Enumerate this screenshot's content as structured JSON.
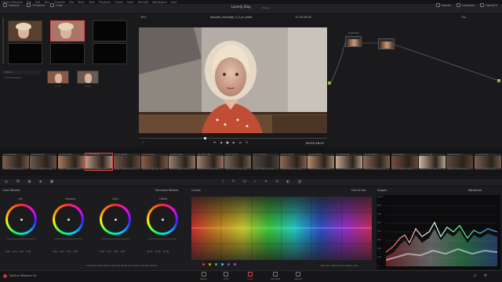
{
  "menu": [
    "DaVinci Resolve",
    "File",
    "Edit",
    "Trim",
    "Timeline",
    "Clip",
    "Mark",
    "View",
    "Playback",
    "Fusion",
    "Color",
    "Fairlight",
    "Workspace",
    "Help"
  ],
  "project_title": "Lovely Day",
  "project_status": "Edited",
  "top_left": {
    "gallery": "Gallery",
    "timelines": "Timeline",
    "clips": "Clips"
  },
  "top_right": {
    "nodes": "Nodes",
    "lightbox": "Lightbox",
    "openfx": "OpenFX"
  },
  "viewer": {
    "zoom": "39%",
    "timeline_name": "episode_montage_4_3_pr_static",
    "timecode": "15:36:28:08",
    "playhead_tc": "00:05:18:07",
    "clip_label": "Clip"
  },
  "media_pool": {
    "folder_name": "Stills 1",
    "power_grades": "PowerGrades 1",
    "stills": [
      {
        "label": "1.1.1",
        "tone": "#5a3e2e"
      },
      {
        "label": "1.1.2",
        "tone": "#a87768"
      },
      {
        "label": "",
        "tone": "#050505"
      },
      {
        "label": "",
        "tone": "#050505"
      },
      {
        "label": "",
        "tone": "#050505"
      },
      {
        "label": "",
        "tone": "#050505"
      }
    ],
    "stills_lower": [
      {
        "label": "1.3.1",
        "tone": "#8a5848"
      },
      {
        "label": "1.4.1",
        "tone": "#6d5a4e"
      }
    ]
  },
  "nodes": {
    "label": "Contrasts",
    "node_ids": [
      "01",
      "02"
    ]
  },
  "timeline_clips": [
    {
      "tc": "11:22:28:10",
      "name": "Apple ProRes 422 HQ",
      "tone": "#7d6050"
    },
    {
      "tc": "16:14:14:23",
      "name": "Apple ProRes 422 HQ",
      "tone": "#6b5a4d"
    },
    {
      "tc": "15:23:37:08",
      "name": "Apple ProRes 422 HQ",
      "tone": "#a77a5c"
    },
    {
      "tc": "15:36:28:08",
      "name": "Apple ProRes 422 HQ",
      "tone": "#c09a84"
    },
    {
      "tc": "15:23:28:09",
      "name": "Apple ProRes 422 HQ",
      "tone": "#6e5644"
    },
    {
      "tc": "15:26:40:12",
      "name": "Apple ProRes 422 HQ",
      "tone": "#8d5e48"
    },
    {
      "tc": "12:21:50:20",
      "name": "Apple ProRes 422 HQ",
      "tone": "#9a8070"
    },
    {
      "tc": "15:46:47:08",
      "name": "Apple ProRes 422 HQ",
      "tone": "#a6806c"
    },
    {
      "tc": "14:27:23:03",
      "name": "Apple ProRes 422 HQ",
      "tone": "#7a6958"
    },
    {
      "tc": "14:47:19:04",
      "name": "Apple ProRes 422 HQ",
      "tone": "#4e4743"
    },
    {
      "tc": "14:27:23:03",
      "name": "Apple ProRes 422 HQ",
      "tone": "#8f6a56"
    },
    {
      "tc": "16:47:08:09",
      "name": "Apple ProRes 422 HQ",
      "tone": "#b48e6f"
    },
    {
      "tc": "15:45:13:00",
      "name": "Apple ProRes 422 HQ",
      "tone": "#c4a894"
    },
    {
      "tc": "14:47:08:09",
      "name": "Apple ProRes 422 HQ",
      "tone": "#8a6a57"
    },
    {
      "tc": "15:26:46:07",
      "name": "Apple ProRes 422 HQ",
      "tone": "#754e3d"
    },
    {
      "tc": "13:43:44:22",
      "name": "Apple ProRes 422 HQ",
      "tone": "#d0b8a4"
    },
    {
      "tc": "16:43:22:22",
      "name": "Apple ProRes 422 HQ",
      "tone": "#5e4b3d"
    },
    {
      "tc": "11:11:17:21",
      "name": "Apple ProRes 422 HQ",
      "tone": "#7a5f50"
    }
  ],
  "color_wheels": {
    "panel_title": "Color Wheels",
    "mode": "Primaries Wheels",
    "wheels": [
      {
        "label": "Lift",
        "values": [
          "0.00",
          "0.00",
          "0.00",
          "0.00"
        ]
      },
      {
        "label": "Gamma",
        "values": [
          "0.00",
          "0.00",
          "0.00",
          "0.00"
        ]
      },
      {
        "label": "Gain",
        "values": [
          "1.00",
          "1.00",
          "1.00",
          "1.00"
        ]
      },
      {
        "label": "Offset",
        "values": [
          "25.00",
          "25.00",
          "25.00"
        ]
      }
    ],
    "bottom_params": "Contrast 1.000  Pivot 0.435  Sat 50.00  Hue 50.00  Lum Mix 100.00"
  },
  "curves": {
    "panel_title": "Curves",
    "mode": "Hue Vs Sat",
    "footer": "Input Hue 256.00  Hue Rotate 0.00"
  },
  "scopes": {
    "panel_title": "Scopes",
    "mode": "Waveform",
    "ticks": [
      "1023",
      "896",
      "768",
      "640",
      "512",
      "384",
      "256",
      "128",
      "0"
    ]
  },
  "status": {
    "app": "DaVinci Resolve 14"
  },
  "pages": [
    "Media",
    "Edit",
    "Color",
    "Fairlight",
    "Deliver"
  ],
  "colors": {
    "accent": "#e0474c",
    "panel": "#1b1b1e",
    "highlight": "#c8a04a"
  }
}
